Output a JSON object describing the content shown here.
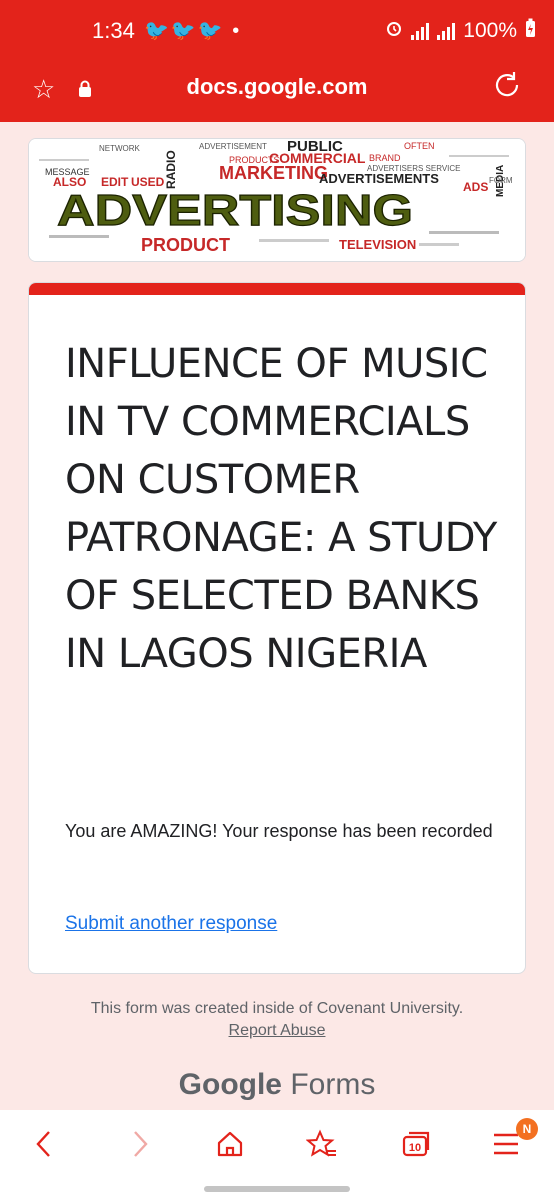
{
  "status_bar": {
    "time": "1:34",
    "left_icons": "🐦🐦🐦 •",
    "battery": "100%"
  },
  "url_bar": {
    "domain": "docs.google.com"
  },
  "banner": {
    "main_word": "ADVERTISING",
    "words": [
      "ADVERTISEMENT",
      "PUBLIC",
      "COMMERCIAL",
      "BRAND",
      "PRODUCTS",
      "MARKETING",
      "ADVERTISEMENTS",
      "ADVERTISERS SERVICE",
      "ADS",
      "FORM",
      "MEDIA",
      "PRODUCT",
      "TELEVISION",
      "EDIT",
      "USED",
      "ALSO",
      "MESSAGE",
      "RADIO",
      "NETWORK",
      "OFTEN"
    ]
  },
  "card": {
    "title": "INFLUENCE OF MUSIC IN TV COMMERCIALS ON CUSTOMER PATRONAGE: A STUDY OF SELECTED BANKS IN LAGOS NIGERIA",
    "message": "You are AMAZING! Your response has been recorded",
    "link": "Submit another response"
  },
  "footer": {
    "created_text": "This form was created inside of Covenant University.",
    "report_link": "Report Abuse",
    "brand_google": "Google",
    "brand_forms": "Forms"
  },
  "bottom_nav": {
    "tabs_count": "10",
    "menu_badge": "N"
  },
  "colors": {
    "accent": "#e3231b",
    "background": "#fce8e6",
    "link": "#1a73e8"
  }
}
